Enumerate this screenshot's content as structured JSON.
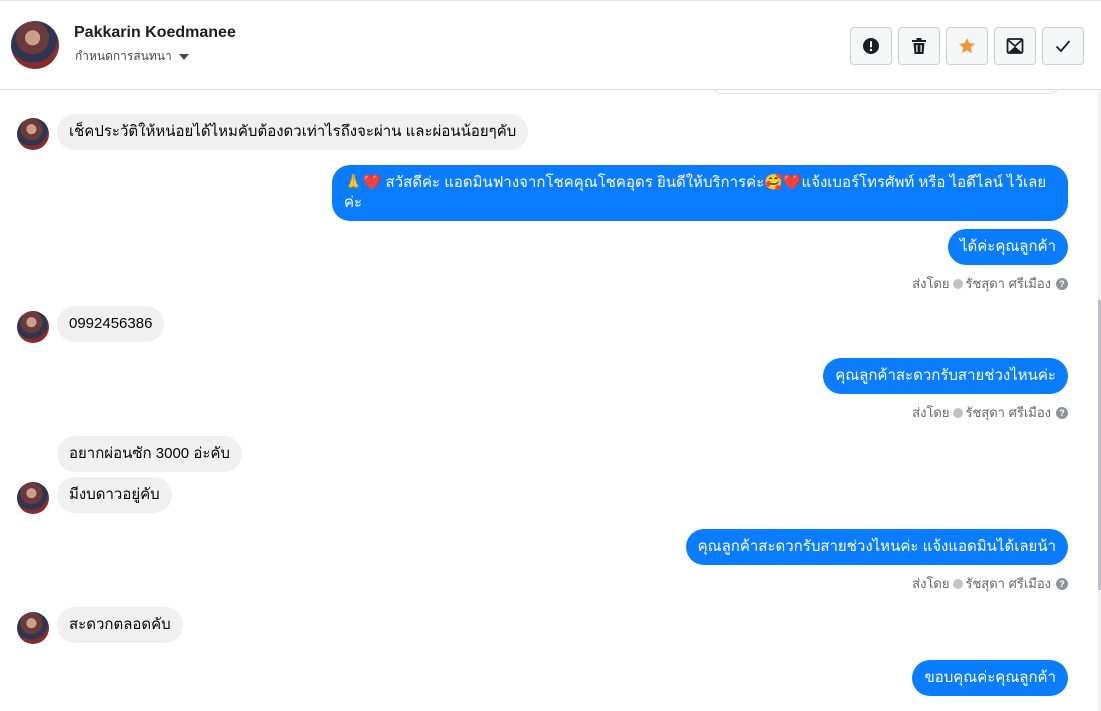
{
  "header": {
    "name": "Pakkarin Koedmanee",
    "assign_label": "กำหนดการสนทนา",
    "actions": [
      {
        "icon": "alert-icon",
        "color": "#1c1e21"
      },
      {
        "icon": "trash-icon",
        "color": "#1c1e21"
      },
      {
        "icon": "star-icon",
        "color": "#f7923b"
      },
      {
        "icon": "mail-icon",
        "color": "#1c1e21"
      },
      {
        "icon": "check-icon",
        "color": "#1c1e21"
      }
    ]
  },
  "messages": {
    "m1": "เช็คประวัติให้หน่อยได้ไหมคับต้องดวเท่าไรถึงจะผ่าน และผ่อนน้อยๆคับ",
    "m2": "🙏❤️ สวัสดีค่ะ แอดมินฟางจากโชคคุณโชคอุดร ยินดีให้บริการค่ะ🥰❤️แจ้งเบอร์โทรศัพท์ หรือ ไอดีไลน์  ไว้เลยค่ะ",
    "m3": "ได้ค่ะคุณลูกค้า",
    "m4": "0992456386",
    "m5": "คุณลูกค้าสะดวกรับสายช่วงไหนค่ะ",
    "m6": "อยากผ่อนซัก 3000 อ่ะคับ",
    "m7": "มีงบดาวอยู่คับ",
    "m8": "คุณลูกค้าสะดวกรับสายช่วงไหนค่ะ   แจ้งแอดมินได้เลยน้า",
    "m9": "สะดวกตลอดคับ",
    "m10": "ขอบคุณค่ะคุณลูกค้า"
  },
  "sent_by": {
    "prefix": "ส่งโดย",
    "agent": "รัชสุดา ศรีเมือง",
    "help": "?"
  },
  "colors": {
    "outgoing": "#0a7cff",
    "incoming": "#f0f0f0"
  }
}
